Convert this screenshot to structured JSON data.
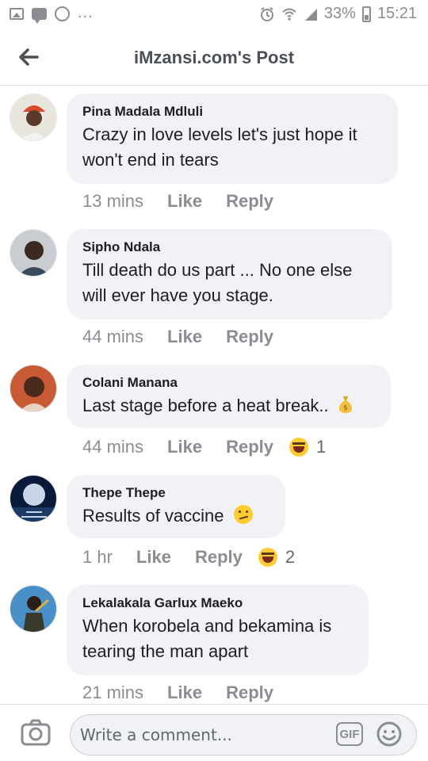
{
  "status_bar": {
    "battery": "33%",
    "time": "15:21",
    "overflow": "..."
  },
  "header": {
    "title": "iMzansi.com's Post"
  },
  "comments": [
    {
      "name": "Pina Madala Mdluli",
      "text_lines": [
        "Crazy in love levels let's just hope it",
        "won't end in tears"
      ],
      "time": "13 mins",
      "like": "Like",
      "reply": "Reply",
      "avatar_color": "#d94a2b"
    },
    {
      "name": "Sipho Ndala",
      "text_lines": [
        "Till death do us part ... No one else",
        "will ever have you stage."
      ],
      "time": "44 mins",
      "like": "Like",
      "reply": "Reply",
      "avatar_color": "#3b4a5c"
    },
    {
      "name": "Colani Manana",
      "text_lines": [
        "Last stage before a heat break.."
      ],
      "emoji": "money-bag-icon",
      "time": "44 mins",
      "like": "Like",
      "reply": "Reply",
      "reaction": {
        "icon": "laughing-emoji-icon",
        "count": "1"
      },
      "avatar_color": "#c85a35"
    },
    {
      "name": "Thepe Thepe",
      "text_lines": [
        "Results of vaccine"
      ],
      "emoji": "confused-emoji-icon",
      "time": "1 hr",
      "like": "Like",
      "reply": "Reply",
      "reaction": {
        "icon": "laughing-emoji-icon",
        "count": "2"
      },
      "avatar_color": "#0a1a3a"
    },
    {
      "name": "Lekalakala Garlux Maeko",
      "text_lines": [
        "When korobela and bekamina is",
        "tearing the man apart"
      ],
      "time": "21 mins",
      "like": "Like",
      "reply": "Reply",
      "avatar_color": "#4a90c8"
    }
  ],
  "composer": {
    "placeholder": "Write a comment...",
    "gif_label": "GIF"
  },
  "colors": {
    "bubble": "#f0f2f5",
    "meta_text": "#8a8d91",
    "title_text": "#4b4f56"
  }
}
